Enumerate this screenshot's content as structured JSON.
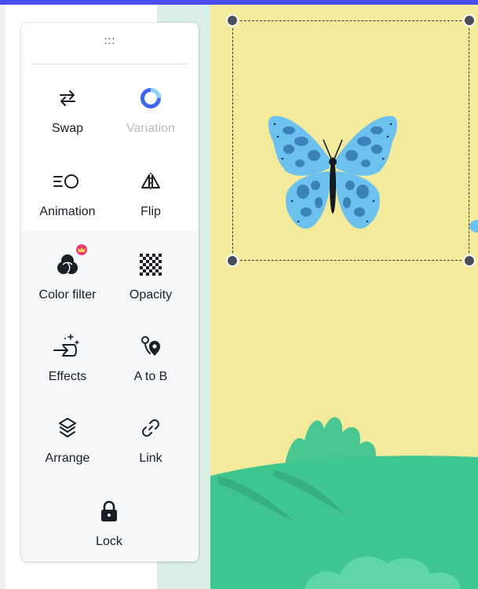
{
  "toolbar": {
    "grip_glyph": ":::",
    "tools": [
      {
        "label": "Swap",
        "icon": "swap-arrows-icon",
        "enabled": true
      },
      {
        "label": "Variation",
        "icon": "variation-ring-icon",
        "enabled": false
      },
      {
        "label": "Animation",
        "icon": "animation-icon",
        "enabled": true
      },
      {
        "label": "Flip",
        "icon": "flip-icon",
        "enabled": true
      },
      {
        "label": "Color filter",
        "icon": "color-filter-icon",
        "enabled": true,
        "badge": "crown-icon"
      },
      {
        "label": "Opacity",
        "icon": "checkerboard-icon",
        "enabled": true
      },
      {
        "label": "Effects",
        "icon": "effects-sparkle-icon",
        "enabled": true
      },
      {
        "label": "A to B",
        "icon": "path-pin-icon",
        "enabled": true
      },
      {
        "label": "Arrange",
        "icon": "layers-icon",
        "enabled": true
      },
      {
        "label": "Link",
        "icon": "link-icon",
        "enabled": true
      },
      {
        "label": "Lock",
        "icon": "padlock-icon",
        "enabled": true
      }
    ]
  },
  "colors": {
    "accent_strip": "#4b4df0",
    "canvas": "#f3ea9c",
    "grass": "#3fc68e",
    "butterfly_wing": "#6cc1ee",
    "butterfly_spots": "#3a82b8",
    "premium_badge": "#f03b72",
    "variation_ring": "#3e66f0"
  }
}
